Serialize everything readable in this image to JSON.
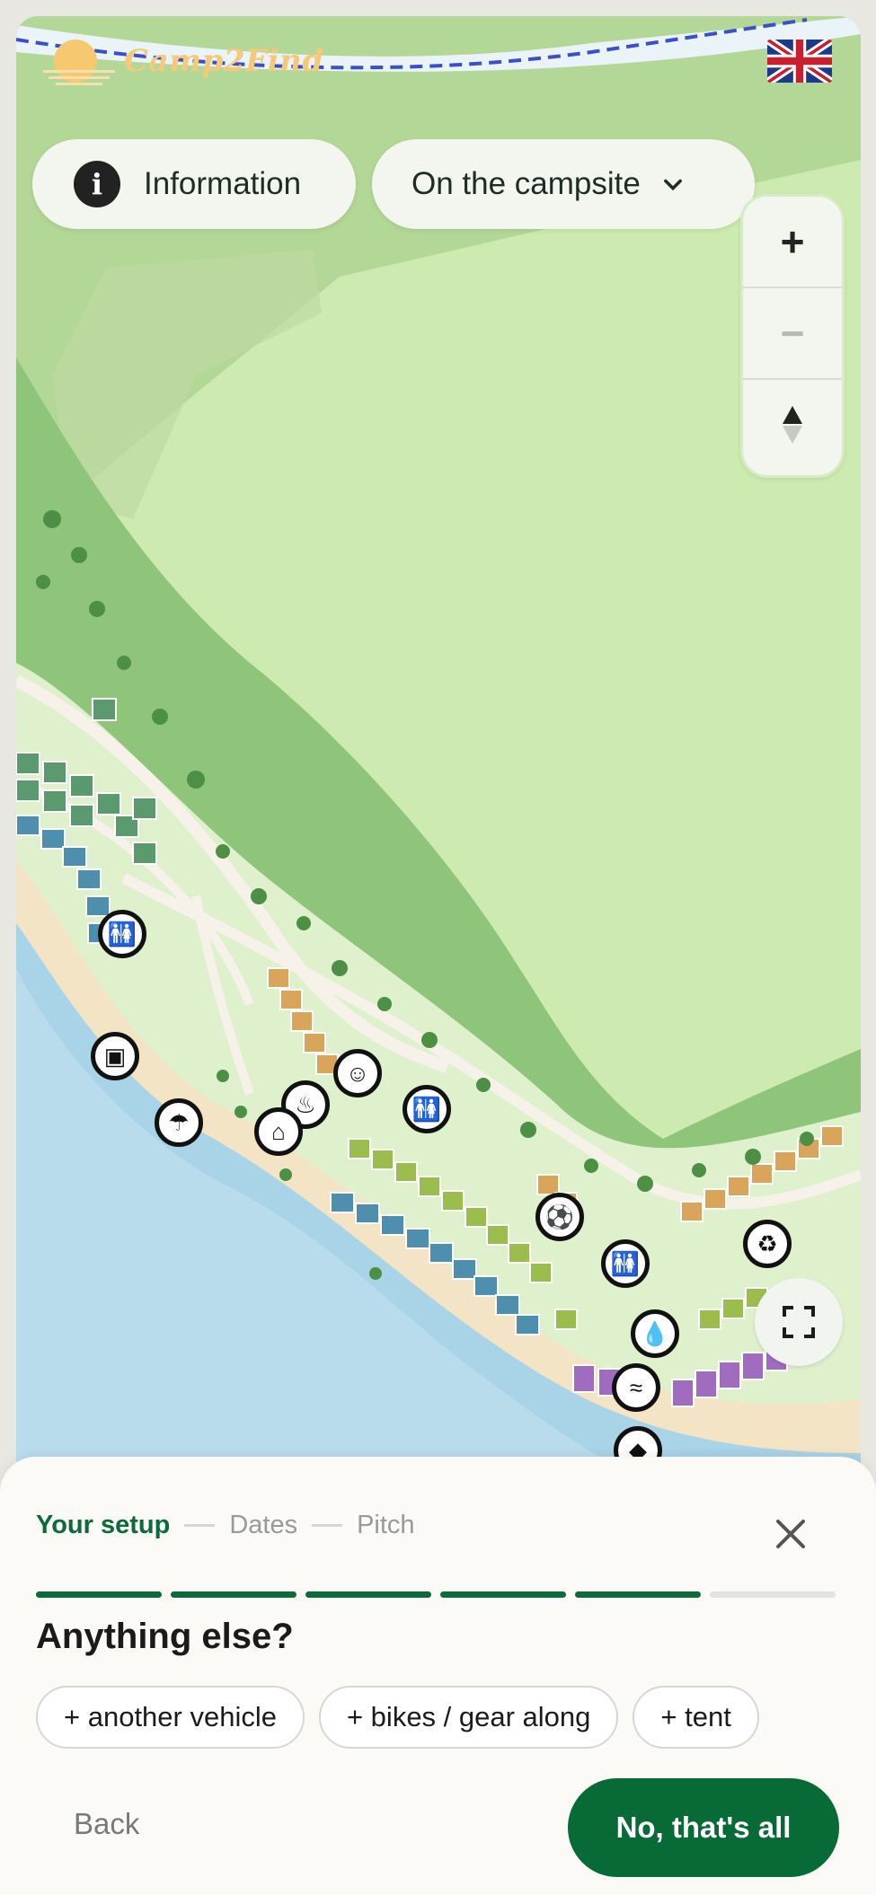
{
  "header": {
    "logo_text": "Camp2Find",
    "language_flag": "uk-flag-icon"
  },
  "map_controls": {
    "info_label": "Information",
    "area_select_label": "On the campsite",
    "zoom_in": "+",
    "zoom_out": "−",
    "fullscreen_icon": "expand-icon"
  },
  "map_markers": [
    "toilets-icon",
    "laundry-icon",
    "beach-umbrella-icon",
    "bbq-icon",
    "fireplace-icon",
    "kids-club-icon",
    "toilets-icon",
    "football-icon",
    "toilets-icon",
    "recycling-icon",
    "car-icon",
    "water-icon",
    "pool-icon",
    "sports-icon"
  ],
  "sheet": {
    "steps": [
      "Your setup",
      "Dates",
      "Pitch"
    ],
    "active_step": "Your setup",
    "progress_total": 6,
    "progress_done": 5,
    "question": "Anything else?",
    "chips": [
      "+ another vehicle",
      "+ bikes / gear along",
      "+ tent"
    ],
    "back_label": "Back",
    "confirm_label": "No, that's all"
  },
  "colors": {
    "accent": "#086a37",
    "map_grass": "#cdeab0",
    "water": "#a9d3e6",
    "beach": "#f2e4c4"
  }
}
